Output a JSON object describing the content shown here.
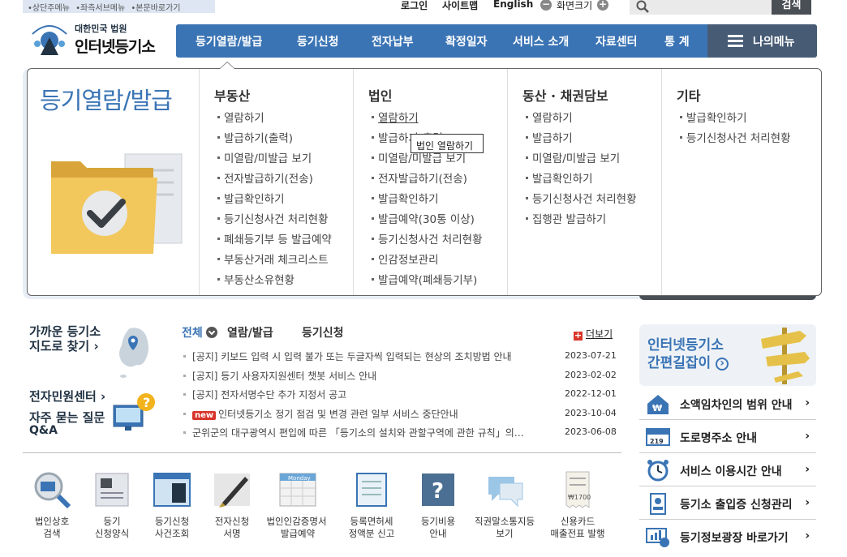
{
  "skip_links": [
    "•상단주메뉴",
    "•좌측서브메뉴",
    "•본문바로가기"
  ],
  "top": {
    "login": "로그인",
    "sitemap": "사이트맵",
    "english": "English",
    "zoom": "화면크기",
    "zoom_minus": "−",
    "zoom_plus": "+",
    "search_btn": "검색"
  },
  "logo": {
    "sub": "대한민국 법원",
    "main": "인터넷등기소"
  },
  "gnb": [
    "등기열람/발급",
    "등기신청",
    "전자납부",
    "확정일자",
    "서비스 소개",
    "자료센터",
    "통 계"
  ],
  "my_menu": "나의메뉴",
  "mega": {
    "title": "등기열람/발급",
    "columns": [
      {
        "head": "부동산",
        "items": [
          "열람하기",
          "발급하기(출력)",
          "미열람/미발급 보기",
          "전자발급하기(전송)",
          "발급확인하기",
          "등기신청사건 처리현황",
          "폐쇄등기부 등 발급예약",
          "부동산거래 체크리스트",
          "부동산소유현황"
        ]
      },
      {
        "head": "법인",
        "items": [
          "열람하기",
          "발급하기(출력)",
          "미열람/미발급 보기",
          "전자발급하기(전송)",
          "발급확인하기",
          "발급예약(30통 이상)",
          "등기신청사건 처리현황",
          "인감정보관리",
          "발급예약(폐쇄등기부)"
        ]
      },
      {
        "head": "동산 · 채권담보",
        "items": [
          "열람하기",
          "발급하기",
          "미열람/미발급 보기",
          "발급확인하기",
          "등기신청사건 처리현황",
          "집행관 발급하기"
        ]
      },
      {
        "head": "기타",
        "items": [
          "발급확인하기",
          "등기신청사건 처리현황"
        ]
      }
    ],
    "tooltip": "법인 열람하기"
  },
  "left": {
    "map_line1": "가까운 등기소",
    "map_line2": "지도로 찾기 ›",
    "center": "전자민원센터 ›",
    "faq_line1": "자주 묻는 질문",
    "faq_line2": "Q&A"
  },
  "tabs": {
    "all": "전체",
    "view": "열람/발급",
    "apply": "등기신청",
    "more": "더보기",
    "more_icon": "+"
  },
  "news": [
    {
      "title": "[공지] 키보드 입력 시 입력 불가 또는 두글자씩 입력되는 현상의 조치방법 안내",
      "date": "2023-07-21",
      "new": ""
    },
    {
      "title": "[공지] 등기 사용자지원센터 챗봇 서비스 안내",
      "date": "2023-02-02",
      "new": ""
    },
    {
      "title": "[공지] 전자서명수단 추가 지정서 공고",
      "date": "2022-12-01",
      "new": ""
    },
    {
      "title": "인터넷등기소 정기 점검 및 변경 관련 일부 서비스 중단안내",
      "date": "2023-10-04",
      "new": "new"
    },
    {
      "title": "군위군의 대구광역시 편입에 따른 「등기소의 설치와 관할구역에 관한 규칙」의…",
      "date": "2023-06-08",
      "new": ""
    }
  ],
  "quick": [
    {
      "l1": "법인상호",
      "l2": "검색"
    },
    {
      "l1": "등기",
      "l2": "신청양식"
    },
    {
      "l1": "등기신청",
      "l2": "사건조회"
    },
    {
      "l1": "전자신청",
      "l2": "서명"
    },
    {
      "l1": "법인인감증명서",
      "l2": "발급예약"
    },
    {
      "l1": "등록면허세",
      "l2": "정액분 신고"
    },
    {
      "l1": "등기비용",
      "l2": "안내"
    },
    {
      "l1": "직권말소통지등",
      "l2": "보기"
    },
    {
      "l1": "신용카드",
      "l2": "매출전표 발행"
    }
  ],
  "quick_icon_text": {
    "calendar": "Monday",
    "question": "?",
    "receipt": "₩1700"
  },
  "guide": {
    "l1": "인터넷등기소",
    "l2": "간편길잡이",
    "arrow": "›"
  },
  "services": [
    {
      "label": "소액임차인의 범위 안내",
      "icon_text": "₩"
    },
    {
      "label": "도로명주소 안내",
      "icon_text": "219"
    },
    {
      "label": "서비스 이용시간 안내",
      "icon_text": ""
    },
    {
      "label": "등기소 출입증 신청관리",
      "icon_text": ""
    },
    {
      "label": "등기정보광장 바로가기",
      "icon_text": ""
    }
  ],
  "chevron": "›"
}
